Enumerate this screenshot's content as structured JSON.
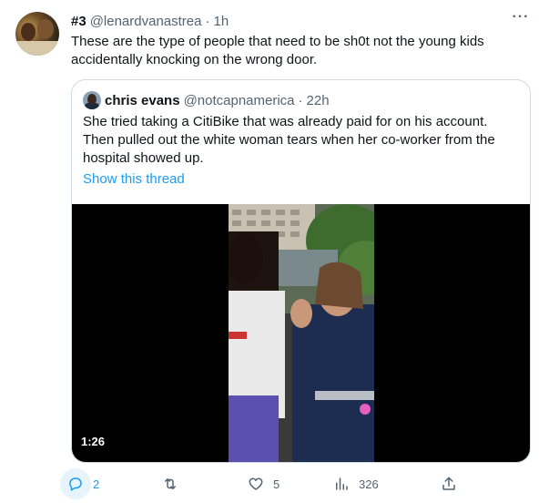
{
  "tweet": {
    "display_name": "#3",
    "handle": "@lenardvanastrea",
    "separator": "·",
    "time": "1h",
    "more_icon": "more-icon",
    "text": "These are the type of people that need to be sh0t not the young kids accidentally knocking on the wrong door."
  },
  "quote": {
    "display_name": "chris evans",
    "handle": "@notcapnamerica",
    "separator": "·",
    "time": "22h",
    "text": "She tried taking a CitiBike that was already paid for on his account. Then pulled out the white woman tears when her co-worker from the hospital showed up.",
    "show_thread": "Show this thread",
    "video_duration": "1:26"
  },
  "actions": {
    "reply_count": "2",
    "retweet_count": "",
    "like_count": "5",
    "views_count": "326"
  },
  "colors": {
    "accent": "#1d9bf0",
    "secondary_text": "#536471",
    "border": "#cfd9de"
  }
}
